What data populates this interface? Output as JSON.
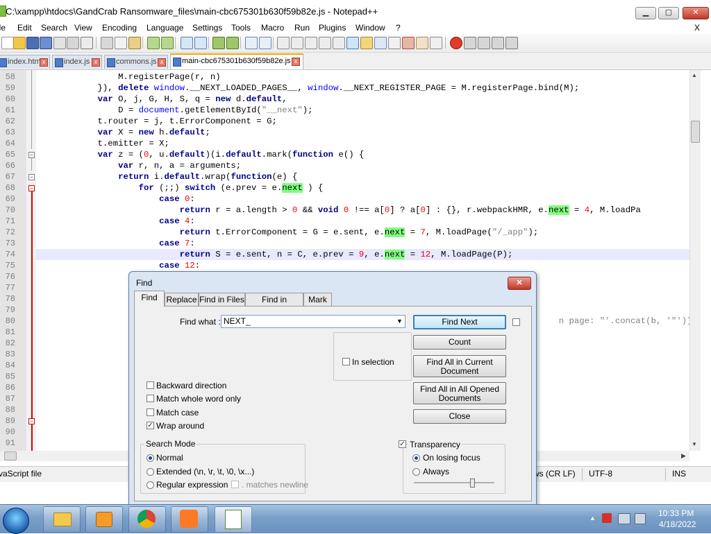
{
  "window": {
    "title": "C:\\xampp\\htdocs\\GandCrab Ransomware_files\\main-cbc675301b630f59b82e.js - Notepad++",
    "minimize_glyph": "▁",
    "maximize_glyph": "▢",
    "close_glyph": "✕"
  },
  "menu": {
    "items": [
      "ile",
      "Edit",
      "Search",
      "View",
      "Encoding",
      "Language",
      "Settings",
      "Tools",
      "Macro",
      "Run",
      "Plugins",
      "Window",
      "?"
    ],
    "close_glyph": "X"
  },
  "tabs": [
    {
      "label": "index.htm"
    },
    {
      "label": "index.js"
    },
    {
      "label": "commons.js"
    },
    {
      "label": "main-cbc675301b630f59b82e.js"
    }
  ],
  "tab_close_glyph": "x",
  "editor": {
    "line_numbers": [
      "58",
      "59",
      "60",
      "61",
      "62",
      "63",
      "64",
      "65",
      "66",
      "67",
      "68",
      "69",
      "70",
      "71",
      "72",
      "73",
      "74",
      "75",
      "76",
      "77",
      "78",
      "79",
      "80",
      "81",
      "82",
      "83",
      "84",
      "85",
      "86",
      "87",
      "88",
      "89",
      "90",
      "91"
    ],
    "current_line": "74",
    "fold_markers": {
      "minus": "−"
    }
  },
  "status": {
    "language": "vaScript file",
    "eol": "ws (CR LF)",
    "encoding": "UTF-8",
    "mode": "INS"
  },
  "find_dialog": {
    "title": "Find",
    "close_glyph": "✕",
    "tabs": [
      "Find",
      "Replace",
      "Find in Files",
      "Find in Projects",
      "Mark"
    ],
    "find_what_label": "Find what :",
    "find_what_value": "NEXT_",
    "dropdown_glyph": "▼",
    "in_selection_label": "In selection",
    "options": [
      {
        "label": "Backward direction",
        "checked": false
      },
      {
        "label": "Match whole word only",
        "checked": false
      },
      {
        "label": "Match case",
        "checked": false
      },
      {
        "label": "Wrap around",
        "checked": true
      }
    ],
    "check_glyph": "✓",
    "search_mode": {
      "title": "Search Mode",
      "options": [
        "Normal",
        "Extended (\\n, \\r, \\t, \\0, \\x...)",
        "Regular expression"
      ],
      "selected": "Normal",
      "matches_newline_label": ". matches newline"
    },
    "buttons": {
      "find_next": "Find Next",
      "count": "Count",
      "find_all_current_1": "Find All in Current",
      "find_all_current_2": "Document",
      "find_all_opened_1": "Find All in All Opened",
      "find_all_opened_2": "Documents",
      "close": "Close"
    },
    "transparency": {
      "label": "Transparency",
      "checked": true,
      "options": [
        "On losing focus",
        "Always"
      ],
      "selected": "On losing focus",
      "level_fraction": 0.7
    }
  },
  "taskbar": {
    "time": "10:33 PM",
    "date": "4/18/2022",
    "tray_arrow": "▲"
  },
  "colors": {
    "keyword": "#00008b",
    "match_highlight": "#80ff80",
    "tab_accent": "#f7a800",
    "dialog_frame": "#dbe6f4"
  }
}
